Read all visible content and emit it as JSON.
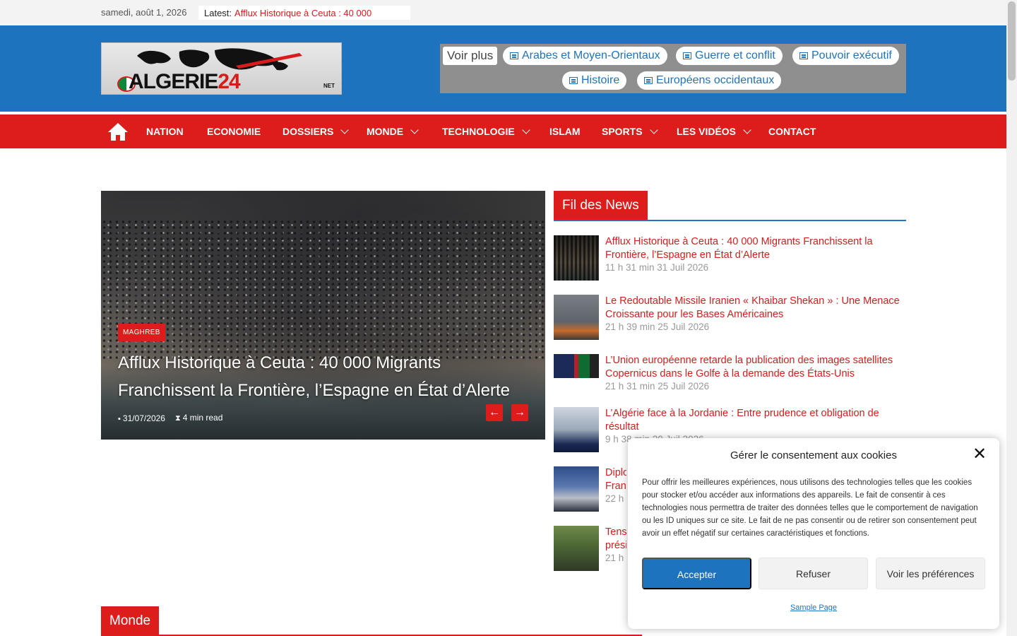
{
  "topbar": {
    "date": "samedi, août 1, 2026",
    "latest_label": "Latest:",
    "latest_text": "Afflux Historique à Ceuta : 40 000"
  },
  "header": {
    "logo_brand": "ALGERIE",
    "logo_num": "24",
    "logo_suffix": "NET",
    "voir_plus": "Voir plus",
    "tags": [
      {
        "label": "Arabes et Moyen-Orientaux",
        "icon": "document-icon"
      },
      {
        "label": "Guerre et conflit",
        "icon": "document-icon"
      },
      {
        "label": "Pouvoir exécutif",
        "icon": "document-icon"
      },
      {
        "label": "Histoire",
        "icon": "document-icon"
      },
      {
        "label": "Européens occidentaux",
        "icon": "document-icon"
      }
    ]
  },
  "nav": {
    "home_icon": "home-icon",
    "items": [
      {
        "label": "NATION",
        "dropdown": false
      },
      {
        "label": "ECONOMIE",
        "dropdown": false
      },
      {
        "label": "DOSSIERS",
        "dropdown": true
      },
      {
        "label": "MONDE",
        "dropdown": true
      },
      {
        "label": "TECHNOLOGIE",
        "dropdown": true
      },
      {
        "label": "ISLAM",
        "dropdown": false
      },
      {
        "label": "SPORTS",
        "dropdown": true
      },
      {
        "label": "LES VIDÉOS",
        "dropdown": true
      },
      {
        "label": "CONTACT",
        "dropdown": false
      }
    ]
  },
  "featured": {
    "category": "MAGHREB",
    "title": "Afflux Historique à Ceuta : 40 000 Migrants Franchissent la Frontière, l’Espagne en État d’Alerte",
    "date": "31/07/2026",
    "read_time": "4 min read"
  },
  "news": {
    "heading": "Fil des News",
    "items": [
      {
        "title": "Afflux Historique à Ceuta : 40 000 Migrants Franchissent la Frontière, l’Espagne en État d’Alerte",
        "time": "11 h 31 min 31 Juil 2026"
      },
      {
        "title": "Le Redoutable Missile Iranien « Khaibar Shekan » : Une Menace Croissante pour les Bases Américaines",
        "time": "21 h 39 min 25 Juil 2026"
      },
      {
        "title": "L’Union européenne retarde la publication des images satellites Copernicus dans le Golfe à la demande des États-Unis",
        "time": "21 h 31 min 25 Juil 2026"
      },
      {
        "title": "L’Algérie face à la Jordanie : Entre prudence et obligation de résultat",
        "time": "9 h 38 min 20 Juil 2026"
      },
      {
        "title": "Diplo Franc",
        "time": "22 h"
      },
      {
        "title": "Tens prési",
        "time": "21 h"
      }
    ]
  },
  "section": {
    "monde": "Monde"
  },
  "cookie": {
    "title": "Gérer le consentement aux cookies",
    "body": "Pour offrir les meilleures expériences, nous utilisons des technologies telles que les cookies pour stocker et/ou accéder aux informations des appareils. Le fait de consentir à ces technologies nous permettra de traiter des données telles que le comportement de navigation ou les ID uniques sur ce site. Le fait de ne pas consentir ou de retirer son consentement peut avoir un effet négatif sur certaines caractéristiques et fonctions.",
    "accept": "Accepter",
    "refuse": "Refuser",
    "prefs": "Voir les préférences",
    "link": "Sample Page"
  },
  "colors": {
    "blue": "#1e73be",
    "red": "#dd1c1c",
    "grey_tagbox": "#8f8f8f"
  }
}
